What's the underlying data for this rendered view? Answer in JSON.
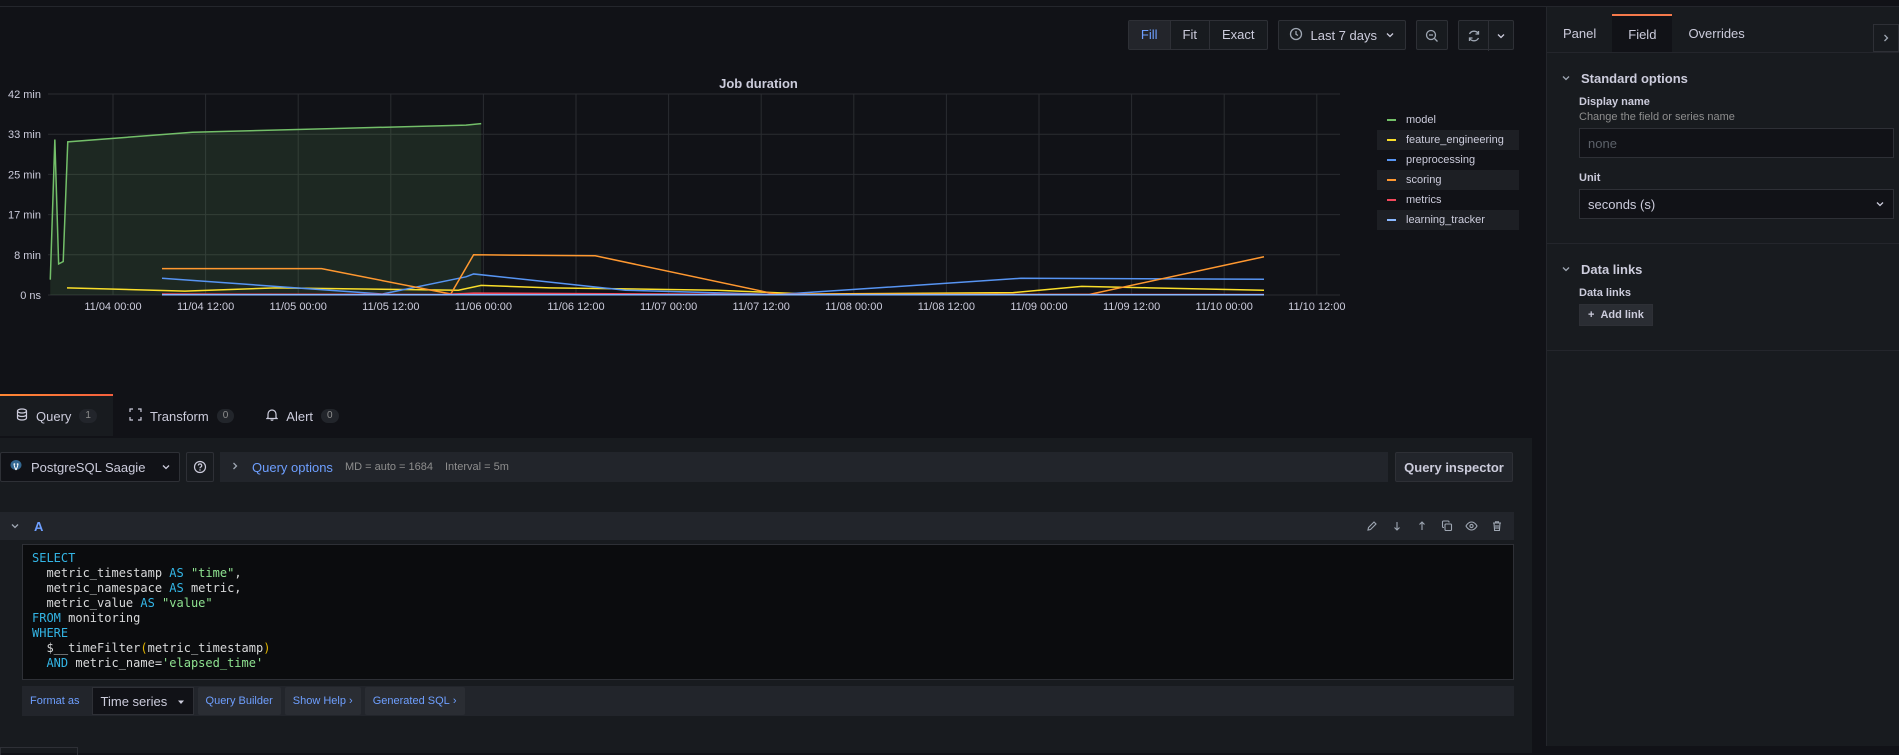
{
  "toolbar": {
    "fill": "Fill",
    "fit": "Fit",
    "exact": "Exact",
    "time_range": "Last 7 days"
  },
  "panel": {
    "title": "Job duration"
  },
  "chart_data": {
    "type": "line",
    "title": "Job duration",
    "y_ticks": [
      "42 min",
      "33 min",
      "25 min",
      "17 min",
      "8 min",
      "0 ns"
    ],
    "ylim": [
      0,
      42
    ],
    "y_unit": "min",
    "x_ticks": [
      "11/04 00:00",
      "11/04 12:00",
      "11/05 00:00",
      "11/05 12:00",
      "11/06 00:00",
      "11/06 12:00",
      "11/07 00:00",
      "11/07 12:00",
      "11/08 00:00",
      "11/08 12:00",
      "11/09 00:00",
      "11/09 12:00",
      "11/10 00:00",
      "11/10 12:00"
    ],
    "x_unit": "hours since 11/03 20:00 (approx)",
    "xlim": [
      0,
      170
    ],
    "legend_position": "right",
    "grid": true,
    "series": [
      {
        "name": "model",
        "color": "#73bf69",
        "fill": true,
        "points": [
          [
            0.3,
            3.2
          ],
          [
            0.9,
            32.5
          ],
          [
            1.4,
            6.5
          ],
          [
            2,
            7
          ],
          [
            2.6,
            32
          ],
          [
            19,
            34
          ],
          [
            55,
            35.5
          ],
          [
            57,
            35.8
          ]
        ]
      },
      {
        "name": "feature_engineering",
        "color": "#fade2a",
        "points": [
          [
            2.5,
            1.5
          ],
          [
            18,
            0.8
          ],
          [
            30,
            1.5
          ],
          [
            54,
            1
          ],
          [
            57,
            2
          ],
          [
            66,
            1.5
          ],
          [
            88,
            1
          ],
          [
            100,
            0.2
          ],
          [
            127,
            0.5
          ],
          [
            136,
            1.8
          ],
          [
            145,
            1.5
          ],
          [
            160,
            1
          ]
        ]
      },
      {
        "name": "preprocessing",
        "color": "#5794f2",
        "points": [
          [
            15,
            3.5
          ],
          [
            44,
            0.2
          ],
          [
            55,
            3.8
          ],
          [
            56,
            4.4
          ],
          [
            76,
            1
          ],
          [
            96,
            0.1
          ],
          [
            128,
            3.5
          ],
          [
            160,
            3.3
          ]
        ]
      },
      {
        "name": "scoring",
        "color": "#ff9830",
        "points": [
          [
            15,
            5.5
          ],
          [
            36,
            5.5
          ],
          [
            53,
            0.2
          ],
          [
            56,
            8.4
          ],
          [
            72,
            8.2
          ],
          [
            96,
            0.1
          ],
          [
            137,
            0.1
          ],
          [
            160,
            8
          ]
        ]
      },
      {
        "name": "metrics",
        "color": "#f2495c",
        "points": [
          [
            15,
            0.2
          ],
          [
            52,
            0.1
          ],
          [
            56,
            0.4
          ],
          [
            95,
            0.1
          ],
          [
            160,
            0.1
          ]
        ]
      },
      {
        "name": "learning_tracker",
        "color": "#8ab8ff",
        "points": [
          [
            15,
            0.05
          ],
          [
            160,
            0.05
          ]
        ]
      }
    ]
  },
  "tabs": [
    {
      "label": "Query",
      "count": "1"
    },
    {
      "label": "Transform",
      "count": "0"
    },
    {
      "label": "Alert",
      "count": "0"
    }
  ],
  "datasource": {
    "name": "PostgreSQL Saagie",
    "query_options_label": "Query options",
    "md": "MD = auto = 1684",
    "interval": "Interval = 5m",
    "inspector": "Query inspector"
  },
  "query": {
    "name": "A",
    "sql": {
      "l1": "SELECT",
      "l2a": "  metric_timestamp ",
      "l2b": "AS",
      "l2c": " \"time\"",
      "l2d": ",",
      "l3a": "  metric_namespace ",
      "l3b": "AS",
      "l3c": " metric,",
      "l4a": "  metric_value ",
      "l4b": "AS",
      "l4c": " \"value\"",
      "l5a": "FROM",
      "l5b": " monitoring",
      "l6": "WHERE",
      "l7a": "  $__timeFilter",
      "l7b": "(",
      "l7c": "metric_timestamp",
      "l7d": ")",
      "l8a": "  AND",
      "l8b": " metric_name=",
      "l8c": "'elapsed_time'"
    },
    "format_as": "Format as",
    "format_value": "Time series",
    "query_builder": "Query Builder",
    "show_help": "Show Help",
    "generated_sql": "Generated SQL"
  },
  "right_panel": {
    "tabs": [
      "Panel",
      "Field",
      "Overrides"
    ],
    "standard_options": "Standard options",
    "display_name_label": "Display name",
    "display_name_desc": "Change the field or series name",
    "display_name_placeholder": "none",
    "unit_label": "Unit",
    "unit_value": "seconds (s)",
    "data_links_section": "Data links",
    "data_links_label": "Data links",
    "add_link": "Add link"
  }
}
